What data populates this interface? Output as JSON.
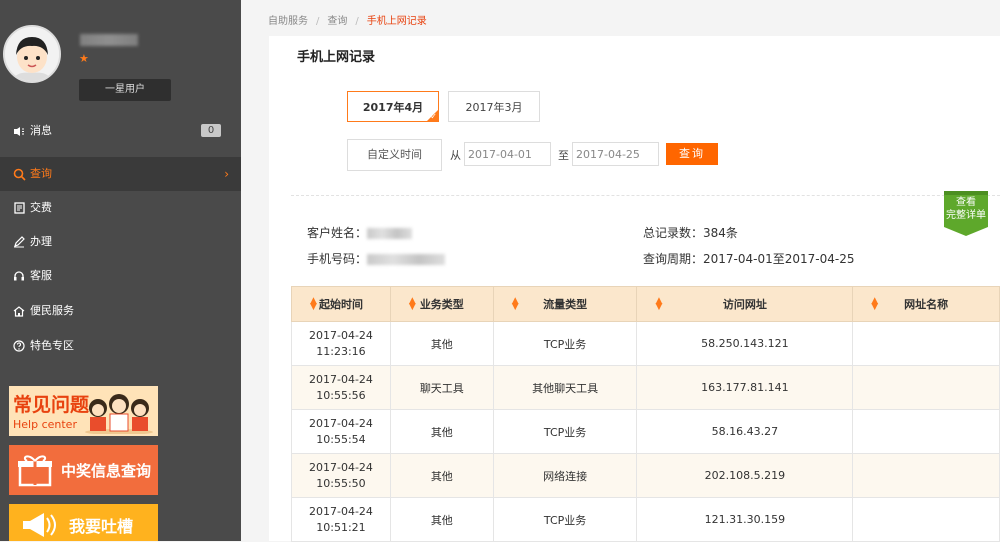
{
  "sidebar": {
    "level_badge": "一星用户",
    "nav": [
      {
        "label": "消息",
        "badge": "0",
        "active": false
      },
      {
        "label": "查询",
        "active": true,
        "arrow": "›"
      },
      {
        "label": "交费",
        "active": false
      },
      {
        "label": "办理",
        "active": false
      },
      {
        "label": "客服",
        "active": false
      },
      {
        "label": "便民服务",
        "active": false
      },
      {
        "label": "特色专区",
        "active": false
      }
    ],
    "promos": {
      "help_title": "常见问题",
      "help_sub": "Help center",
      "prize": "中奖信息查询",
      "complain": "我要吐槽"
    }
  },
  "breadcrumb": [
    "自助服务",
    "查询",
    "手机上网记录"
  ],
  "page_title": "手机上网记录",
  "tabs": [
    {
      "label": "2017年4月",
      "selected": true
    },
    {
      "label": "2017年3月",
      "selected": false
    }
  ],
  "filter": {
    "custom_label": "自定义时间",
    "from_label": "从",
    "to_label": "至",
    "from_value": "2017-04-01",
    "to_value": "2017-04-25",
    "query_label": "查询"
  },
  "detail_ribbon": {
    "line1": "查看",
    "line2": "完整详单"
  },
  "info": {
    "name_label": "客户姓名：",
    "phone_label": "手机号码：",
    "total_label": "总记录数：384条",
    "period_label": "查询周期：2017-04-01至2017-04-25"
  },
  "table": {
    "headers": [
      "起始时间",
      "业务类型",
      "流量类型",
      "访问网址",
      "网址名称"
    ],
    "rows": [
      {
        "date": "2017-04-24",
        "time": "11:23:16",
        "biz": "其他",
        "flow": "TCP业务",
        "url": "58.250.143.121",
        "name": ""
      },
      {
        "date": "2017-04-24",
        "time": "10:55:56",
        "biz": "聊天工具",
        "flow": "其他聊天工具",
        "url": "163.177.81.141",
        "name": ""
      },
      {
        "date": "2017-04-24",
        "time": "10:55:54",
        "biz": "其他",
        "flow": "TCP业务",
        "url": "58.16.43.27",
        "name": ""
      },
      {
        "date": "2017-04-24",
        "time": "10:55:50",
        "biz": "其他",
        "flow": "网络连接",
        "url": "202.108.5.219",
        "name": ""
      },
      {
        "date": "2017-04-24",
        "time": "10:51:21",
        "biz": "其他",
        "flow": "TCP业务",
        "url": "121.31.30.159",
        "name": ""
      }
    ]
  },
  "colors": {
    "accent": "#ff7a1a",
    "query_button": "#ff6600",
    "sidebar_bg": "#4a4a4a",
    "header_bg": "#fbe7cc"
  }
}
